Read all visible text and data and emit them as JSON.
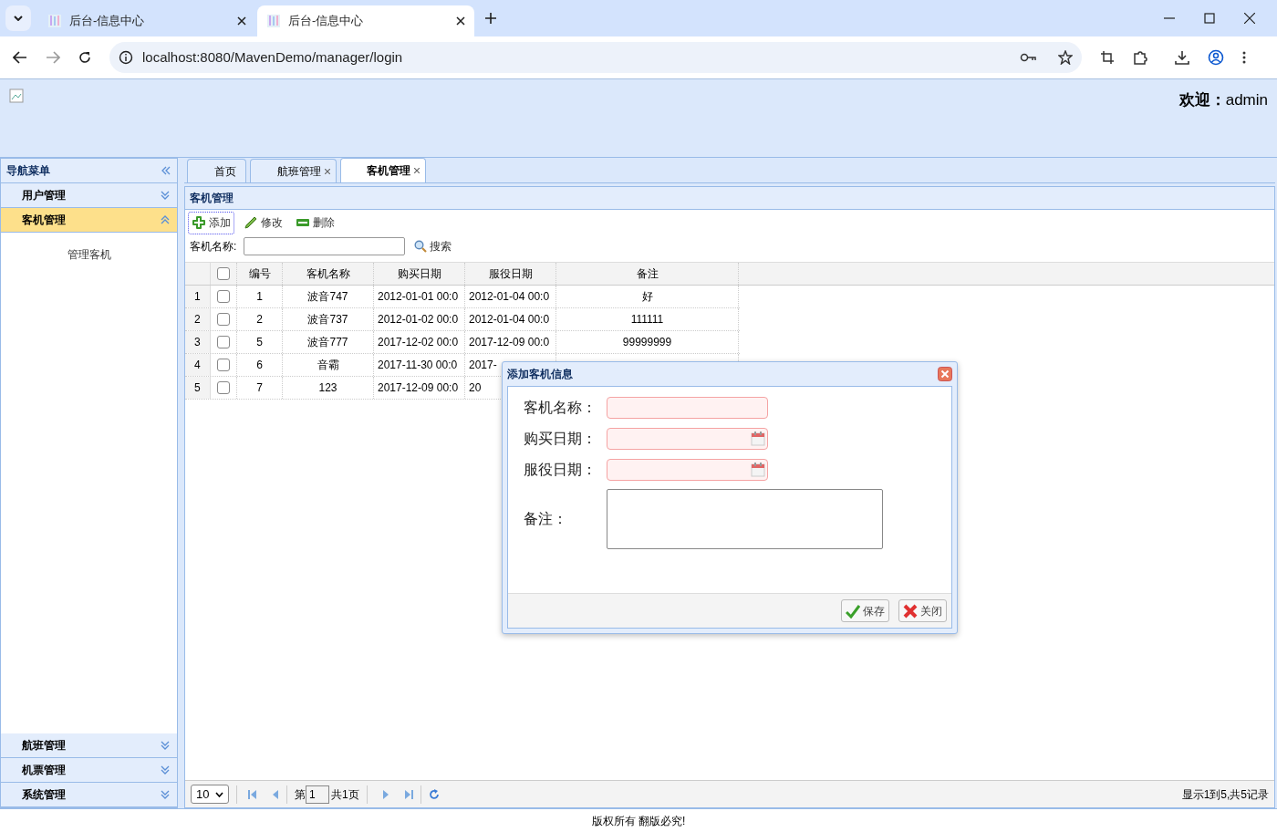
{
  "browser": {
    "tabs": [
      {
        "title": "后台-信息中心",
        "selected": false
      },
      {
        "title": "后台-信息中心",
        "selected": true
      }
    ],
    "url": "localhost:8080/MavenDemo/manager/login"
  },
  "header": {
    "welcome": "**欢迎：**admin"
  },
  "nav": {
    "title": "导航菜单",
    "sections": [
      {
        "label": "用户管理",
        "expanded": false
      },
      {
        "label": "客机管理",
        "expanded": true,
        "items": [
          "管理客机"
        ]
      },
      {
        "label": "航班管理",
        "expanded": false
      },
      {
        "label": "机票管理",
        "expanded": false
      },
      {
        "label": "系统管理",
        "expanded": false
      }
    ]
  },
  "tabs": [
    {
      "label": "首页",
      "closable": false,
      "selected": false
    },
    {
      "label": "航班管理",
      "closable": true,
      "selected": false
    },
    {
      "label": "客机管理",
      "closable": true,
      "selected": true
    }
  ],
  "panel": {
    "title": "客机管理",
    "toolbar": [
      {
        "kind": "add",
        "label": "添加"
      },
      {
        "kind": "edit",
        "label": "修改"
      },
      {
        "kind": "delete",
        "label": "删除"
      }
    ],
    "search": {
      "label": "客机名称:",
      "button": "搜索"
    },
    "table": {
      "select_all_checked": false,
      "columns": [
        "编号",
        "客机名称",
        "购买日期",
        "服役日期",
        "备注"
      ],
      "rows": [
        {
          "num": "1",
          "checked": false,
          "cells": [
            "1",
            "波音747",
            "2012-01-01 00:0",
            "2012-01-04 00:0",
            "好"
          ]
        },
        {
          "num": "2",
          "checked": false,
          "cells": [
            "2",
            "波音737",
            "2012-01-02 00:0",
            "2012-01-04 00:0",
            "111111"
          ]
        },
        {
          "num": "3",
          "checked": false,
          "cells": [
            "5",
            "波音777",
            "2017-12-02 00:0",
            "2017-12-09 00:0",
            "99999999"
          ]
        },
        {
          "num": "4",
          "checked": false,
          "cells": [
            "6",
            "音霸",
            "2017-11-30 00:0",
            "2017-"
          ]
        },
        {
          "num": "5",
          "checked": false,
          "cells": [
            "7",
            "123",
            "2017-12-09 00:0",
            "20"
          ]
        }
      ]
    },
    "pager": {
      "page_size": "10",
      "page_label": "第",
      "page": "1",
      "total_pages": "共1页",
      "summary": "显示1到5,共5记录"
    }
  },
  "dialog": {
    "title": "添加客机信息",
    "fields": [
      {
        "kind": "text",
        "label": "客机名称：",
        "invalid": true
      },
      {
        "kind": "date",
        "label": "购买日期：",
        "invalid": true
      },
      {
        "kind": "date",
        "label": "服役日期：",
        "invalid": true
      },
      {
        "kind": "textarea",
        "label": "备注：",
        "invalid": false
      }
    ],
    "buttons": [
      {
        "kind": "save",
        "label": "保存"
      },
      {
        "kind": "close",
        "label": "关闭"
      }
    ]
  },
  "footer": "版权所有 翻版必究!"
}
